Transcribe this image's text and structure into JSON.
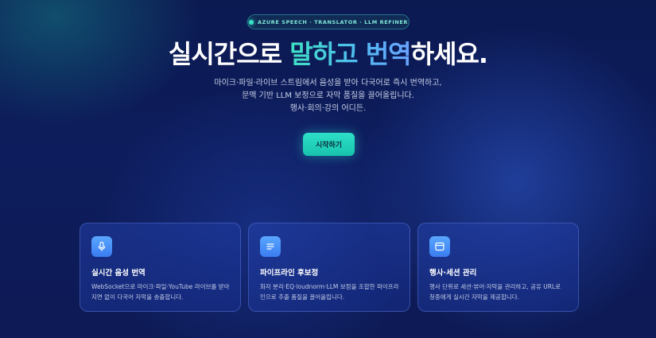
{
  "badge": {
    "text": "AZURE SPEECH · TRANSLATOR · LLM REFINER"
  },
  "hero": {
    "title_part1": "실시간으로 ",
    "title_highlight": "말하고 번역",
    "title_part2": "하세요.",
    "subtitle_lines": [
      "마이크·파일·라이브 스트림에서 음성을 받아 다국어로 즉시 번역하고,",
      "문맥 기반 LLM 보정으로 자막 품질을 끌어올립니다.",
      "행사·회의·강의 어디든."
    ],
    "cta_label": "시작하기"
  },
  "features": [
    {
      "icon": "microphone-icon",
      "title": "실시간 음성 번역",
      "desc_lines": [
        "WebSocket으로 마이크·파일·YouTube 라이브를 받아",
        "지연 없이 다국어 자막을 송출합니다."
      ]
    },
    {
      "icon": "document-lines-icon",
      "title": "파이프라인 후보정",
      "desc_lines": [
        "화자 분리·EQ·loudnorm·LLM 보정을 조합한 파이프라",
        "인으로 추출 품질을 끌어올립니다."
      ]
    },
    {
      "icon": "window-icon",
      "title": "행사·세션 관리",
      "desc_lines": [
        "행사 단위로 세션·뷰어·자막을 관리하고, 공유 URL로",
        "청중에게 실시간 자막을 제공합니다."
      ]
    }
  ],
  "colors": {
    "accent_teal": "#2ee0c8",
    "accent_blue": "#5aa7ff",
    "background": "#0d1c5c"
  }
}
